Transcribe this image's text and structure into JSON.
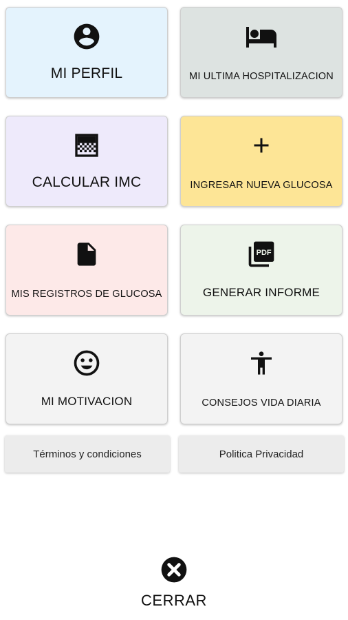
{
  "tiles": {
    "profile": {
      "label": "MI PERFIL",
      "color": "#e4f3fd",
      "icon": "account-circle-icon"
    },
    "hospitalization": {
      "label": "MI ULTIMA HOSPITALIZACION",
      "color": "#dde3e1",
      "icon": "hotel-bed-icon"
    },
    "imc": {
      "label": "CALCULAR IMC",
      "color": "#eeeafb",
      "icon": "gradient-grid-icon"
    },
    "new_glucose": {
      "label": "INGRESAR NUEVA GLUCOSA",
      "color": "#fde596",
      "icon": "plus-icon"
    },
    "records": {
      "label": "MIS REGISTROS DE GLUCOSA",
      "color": "#fde9e8",
      "icon": "document-icon"
    },
    "report": {
      "label": "GENERAR INFORME",
      "color": "#edf4ea",
      "icon": "pdf-icon"
    },
    "motivation": {
      "label": "MI MOTIVACION",
      "color": "#f3f3f3",
      "icon": "smiley-icon"
    },
    "tips": {
      "label": "CONSEJOS VIDA DIARIA",
      "color": "#f3f3f3",
      "icon": "accessibility-icon"
    }
  },
  "links": {
    "terms": "Términos y condiciones",
    "privacy": "Politica Privacidad"
  },
  "close": {
    "label": "CERRAR"
  }
}
